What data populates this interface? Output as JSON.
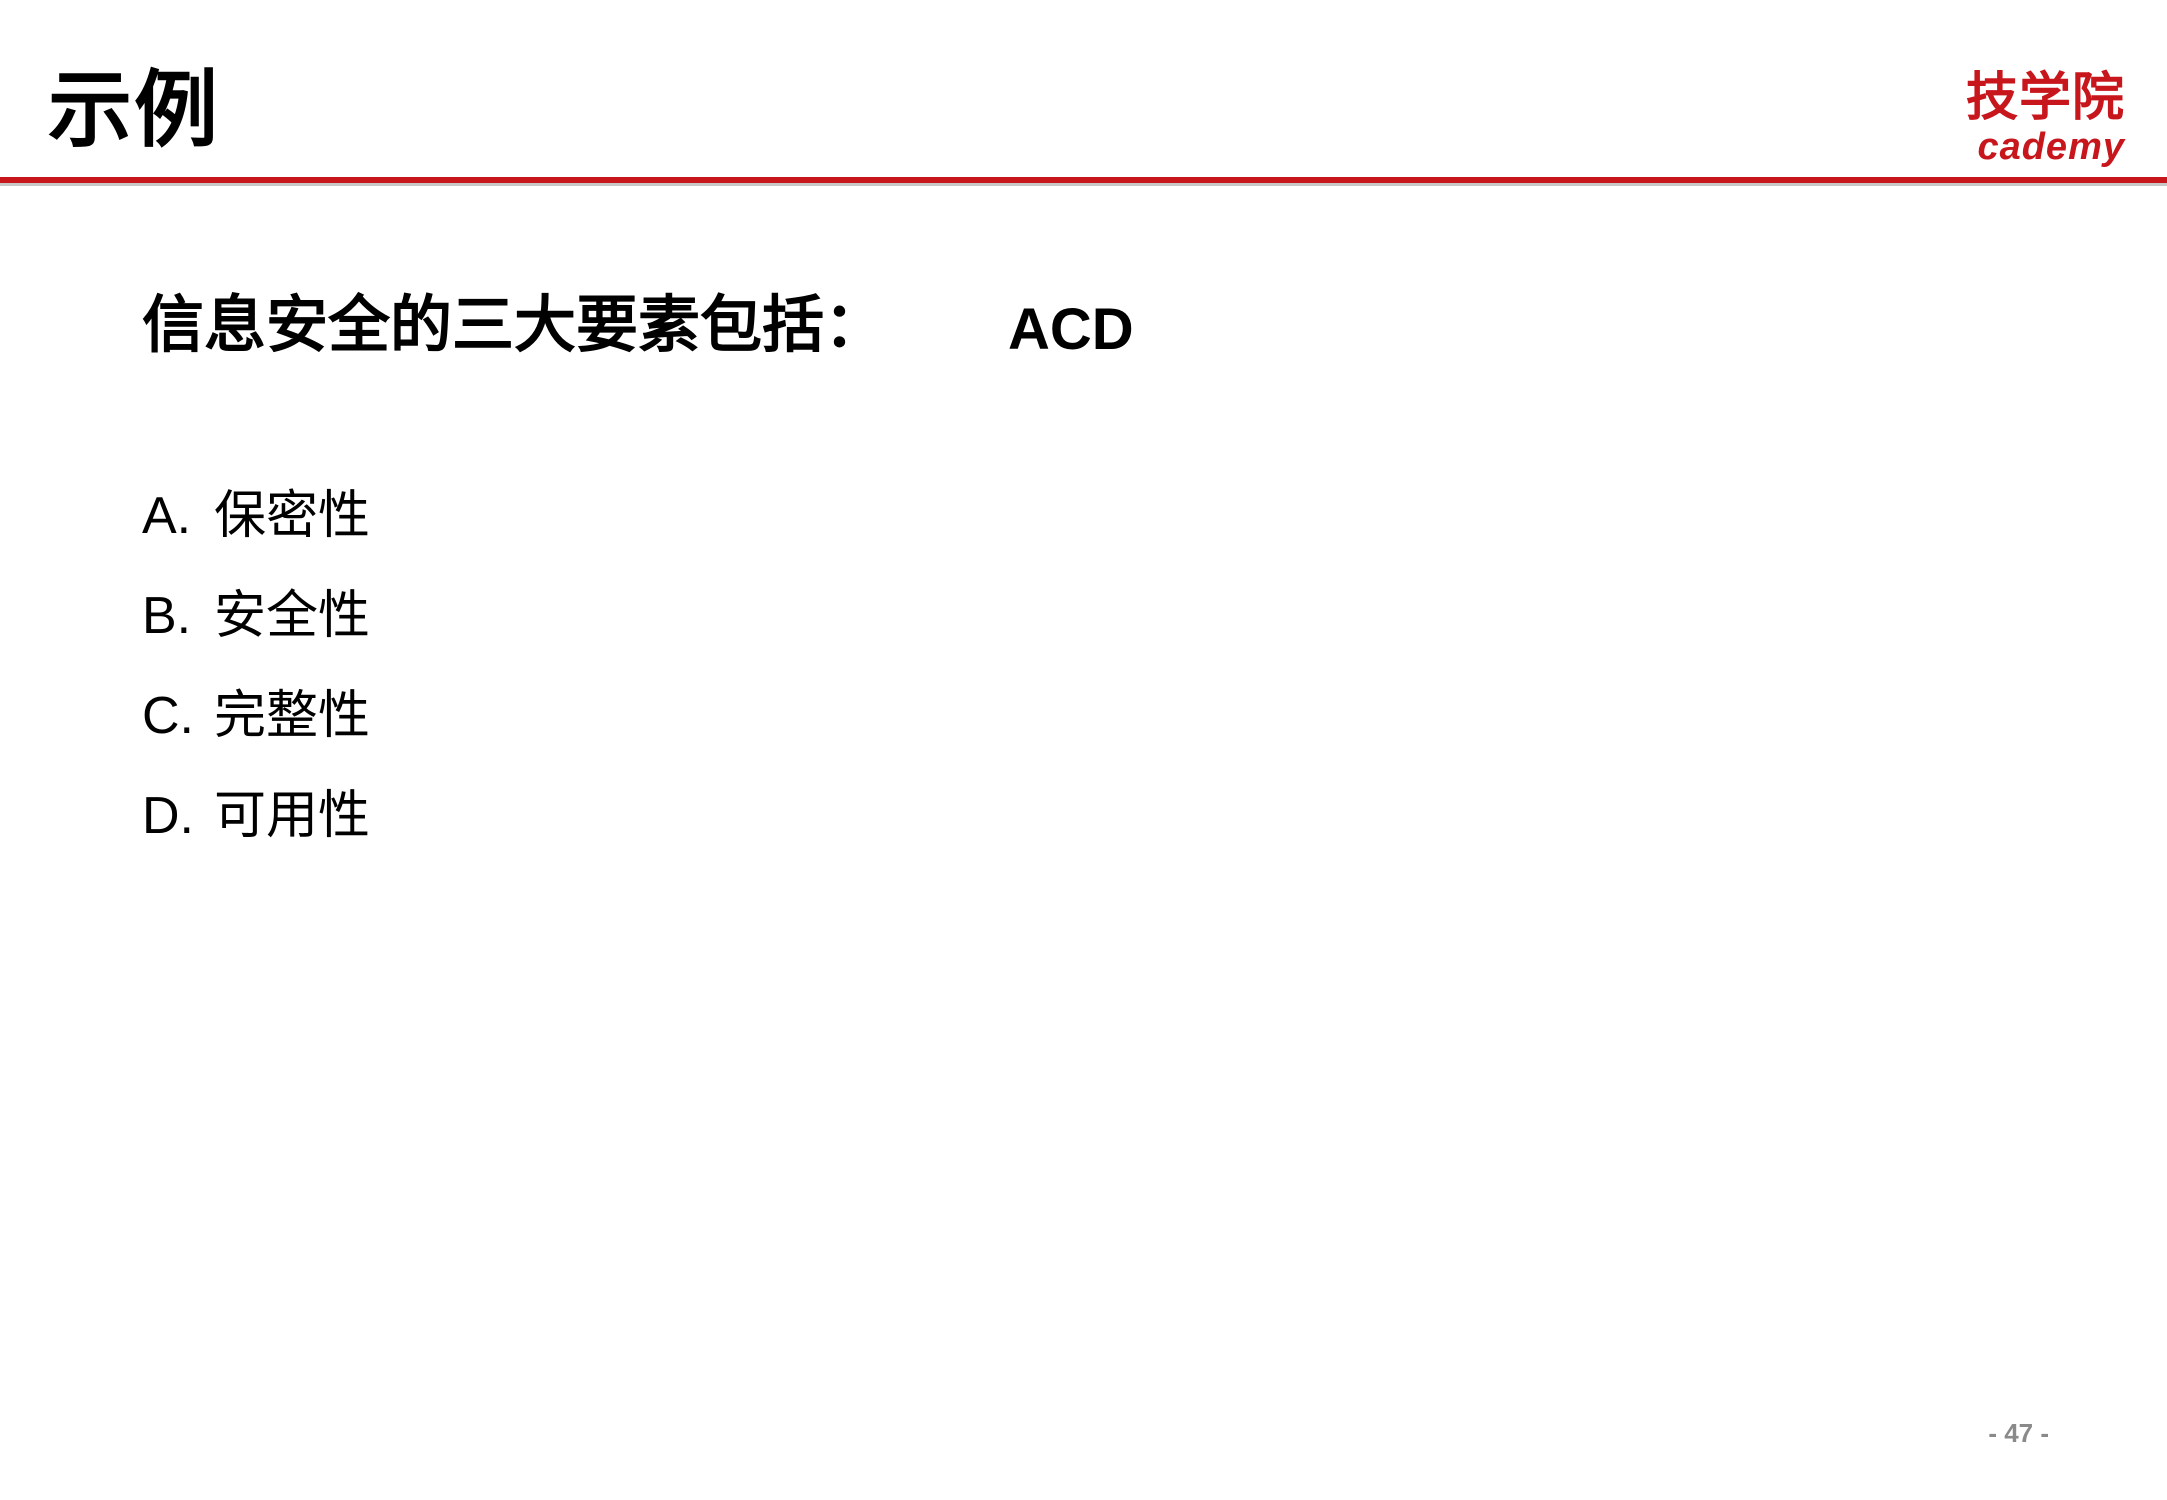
{
  "header": {
    "title": "示例",
    "logo_cn": "技学院",
    "logo_en": "cademy"
  },
  "question": {
    "text": "信息安全的三大要素包括：",
    "answer": "ACD"
  },
  "options": [
    {
      "letter": "A.",
      "text": "保密性"
    },
    {
      "letter": "B.",
      "text": "安全性"
    },
    {
      "letter": "C.",
      "text": "完整性"
    },
    {
      "letter": "D.",
      "text": "可用性"
    }
  ],
  "footer": {
    "page_number": "- 47 -"
  },
  "colors": {
    "accent": "#c8161d",
    "text": "#000000",
    "page_number": "#8a8a8a"
  }
}
